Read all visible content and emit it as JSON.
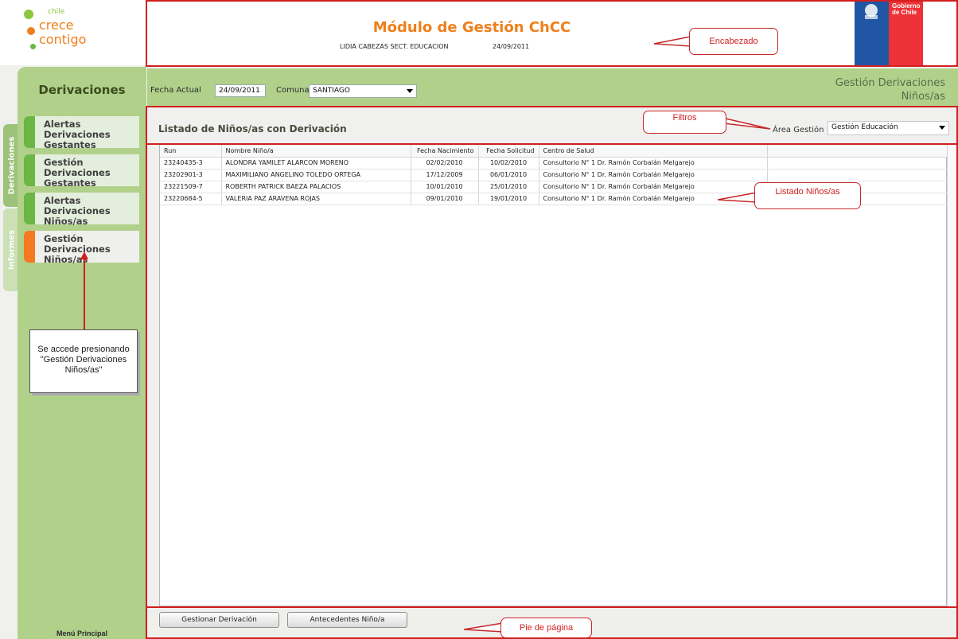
{
  "logo": {
    "small": "chile",
    "line1": "crece",
    "line2": "contigo"
  },
  "header": {
    "title": "Módulo de Gestión ChCC",
    "user": "LIDIA CABEZAS SECT. EDUCACION",
    "date": "24/09/2011",
    "gob_line1": "Gobierno",
    "gob_line2": "de Chile"
  },
  "side_tabs": [
    "Derivaciones",
    "Informes"
  ],
  "sidebar": {
    "title": "Derivaciones",
    "items": [
      {
        "label": "Alertas Derivaciones Gestantes"
      },
      {
        "label": "Gestión Derivaciones Gestantes"
      },
      {
        "label": "Alertas Derivaciones Niños/as"
      },
      {
        "label": "Gestión Derivaciones Niños/as"
      }
    ],
    "footer": "Menú Principal"
  },
  "filters": {
    "fecha_label": "Fecha Actual",
    "fecha_value": "24/09/2011",
    "comuna_label": "Comuna",
    "comuna_value": "SANTIAGO",
    "section_line1": "Gestión Derivaciones",
    "section_line2": "Niños/as"
  },
  "list": {
    "title": "Listado de Niños/as con Derivación",
    "area_label": "Área Gestión",
    "area_value": "Gestión Educación",
    "columns": [
      "Run",
      "Nombre Niño/a",
      "Fecha Nacimiento",
      "Fecha Solicitud",
      "Centro de Salud",
      ""
    ],
    "rows": [
      [
        "23240435-3",
        "ALONDRA YAMILET ALARCON MORENO",
        "02/02/2010",
        "10/02/2010",
        "Consultorio N° 1 Dr. Ramón Corbalán Melgarejo"
      ],
      [
        "23202901-3",
        "MAXIMILIANO ANGELINO TOLEDO ORTEGA",
        "17/12/2009",
        "06/01/2010",
        "Consultorio N° 1 Dr. Ramón Corbalán Melgarejo"
      ],
      [
        "23221509-7",
        "ROBERTH PATRICK BAEZA PALACIOS",
        "10/01/2010",
        "25/01/2010",
        "Consultorio N° 1 Dr. Ramón Corbalán Melgarejo"
      ],
      [
        "23220684-5",
        "VALERIA PAZ ARAVENA ROJAS",
        "09/01/2010",
        "19/01/2010",
        "Consultorio N° 1 Dr. Ramón Corbalán Melgarejo"
      ]
    ]
  },
  "footer": {
    "btn_gestionar": "Gestionar Derivación",
    "btn_antecedentes": "Antecedentes Niño/a"
  },
  "annotations": {
    "encabezado": "Encabezado",
    "filtros": "Filtros",
    "listado": "Listado Niños/as",
    "pie": "Pie de página",
    "note": "Se accede presionando \"Gestión Derivaciones Niños/as\""
  },
  "colors": {
    "accent_orange": "#ef7f1a",
    "sidebar_green": "#b1d18b",
    "annotation_red": "#d21f1f",
    "gob_blue": "#2156a5",
    "gob_red": "#ed3237"
  }
}
